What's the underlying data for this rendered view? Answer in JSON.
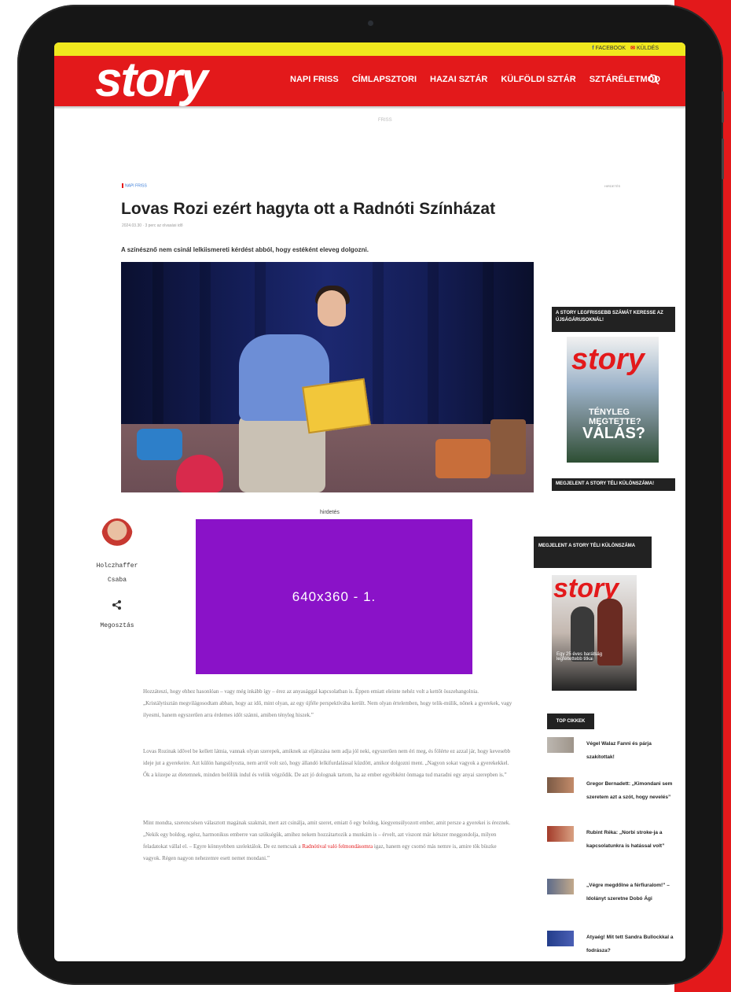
{
  "site": {
    "logo": "story",
    "top_links": {
      "facebook": "FACEBOOK",
      "mail": "KÜLDÉS"
    },
    "nav": [
      "NAPI FRISS",
      "CÍMLAPSZTORI",
      "HAZAI SZTÁR",
      "KÜLFÖLDI SZTÁR",
      "SZTÁRÉLETMÓD"
    ],
    "tagline": "FRISS"
  },
  "article": {
    "category": "NAPI FRISS",
    "category_right": "HIRDETÉS",
    "title": "Lovas Rozi ezért hagyta ott a Radnóti Színházat",
    "meta": "2024.03.30 · 3 perc az olvasási idő",
    "lead": "A színésznő nem csinál lelkiismereti kérdést abból, hogy estéként eleveg dolgozni.",
    "author": "Holczhaffer Csaba",
    "share": "Megosztás",
    "ad_label": "hirdetés",
    "ad_text": "640x360 - 1.",
    "paragraphs": [
      "Hozzáteszi, hogy ehhez hasonlóan – vagy még inkább így – érez az anyasággal kapcsolatban is. Éppen emiatt eleinte nehéz volt a kettőt összehangolnia. „Kristálytisztán megvilágosodtam abban, hogy az idő, mint olyan, az egy újféle perspektívába került. Nem olyan értelemben, hogy telik-múlik, nőnek a gyerekek, vagy ilyesmi, hanem egyszerűen arra érdemes időt szánni, amiben tényleg hiszek.”",
      "Lovas Rozinak idővel be kellett látnia, vannak olyan szerepek, amiknek az eljátszása nem adja jól neki, egyszerűen nem éri meg, és fölérte ez azzal jár, hogy kevesebb ideje jut a gyerekeire. Azt külön hangsúlyozta, nem arról volt szó, hogy állandó lelkifurdalással küzdött, amikor dolgozni ment. „Nagyon sokat vagyok a gyerekekkel. Ők a közepe az életemnek, minden belőlük indul és velük végződik. De azt jó dolognak tartom, ha az ember egyébként önmaga tud maradni egy anyai szerepben is.”",
      "Mint mondta, szerencsésen választott magának szakmát, mert azt csinálja, amit szeret, emiatt ő egy boldog, kiegyensúlyozott ember, amit persze a gyerekei is éreznek. „Nekik egy boldog, egész, harmonikus emberre van szükségük, amihez nekem hozzátartozik a munkám is – érvelt, azt viszont már kétszer meggondolja, milyen feladatokat vállal el. – Egyre könnyebben szelektálok. De ez nemcsak a",
      "Radnótival való felmondásomra",
      "igaz, hanem egy csomó más nemre is, amire tök büszke vagyok. Régen nagyon nehezemre esett nemet mondani.”"
    ]
  },
  "sidebar": {
    "promo1_title": "A STORY LEGFRISSEBB SZÁMÁT KERESSE AZ ÚJSÁGÁRUSOKNÁL!",
    "promo1_cover_text": "VÁLÁS?",
    "promo1_cover_small": "TÉNYLEG MEGTETTE?",
    "promo1_bottom": "MEGJELENT A STORY TÉLI KÜLÖNSZÁMA!",
    "promo2_title": "MEGJELENT A STORY TÉLI KÜLÖNSZÁMA",
    "promo2_cover_text": "Egy 25 éves barátság legféltettebb titkai",
    "top_title": "TOP CIKKEK",
    "top_articles": [
      "Végel Walaz Fanni és párja szakítottak!",
      "Gregor Bernadett: „Kimondani sem szeretem azt a szót, hogy nevelés”",
      "Rubint Réka: „Norbi stroke-ja a kapcsolatunkra is hatással volt”",
      "„Végre megdőlne a férfiuralom!” – Idolányt szeretne Dobó Ági",
      "Atyaég! Mit tett Sandra Bullockkal a fodrásza?"
    ]
  },
  "colors": {
    "brand_red": "#e3191b",
    "top_yellow": "#f0e81e",
    "ad_purple": "#8a12c8"
  }
}
